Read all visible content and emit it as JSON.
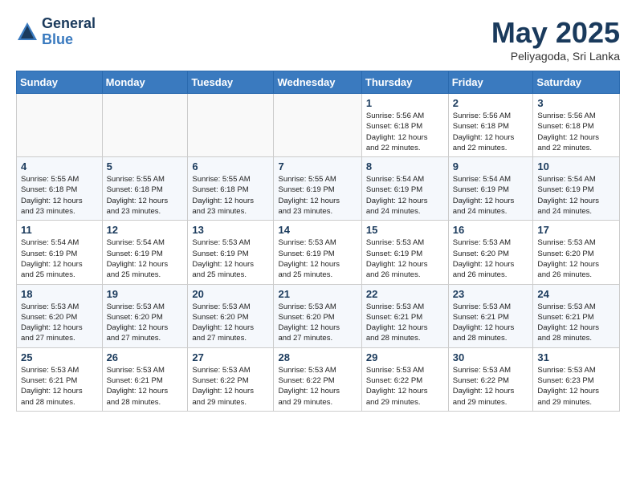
{
  "header": {
    "logo_general": "General",
    "logo_blue": "Blue",
    "month_title": "May 2025",
    "location": "Peliyagoda, Sri Lanka"
  },
  "days_of_week": [
    "Sunday",
    "Monday",
    "Tuesday",
    "Wednesday",
    "Thursday",
    "Friday",
    "Saturday"
  ],
  "weeks": [
    [
      {
        "day": "",
        "info": ""
      },
      {
        "day": "",
        "info": ""
      },
      {
        "day": "",
        "info": ""
      },
      {
        "day": "",
        "info": ""
      },
      {
        "day": "1",
        "info": "Sunrise: 5:56 AM\nSunset: 6:18 PM\nDaylight: 12 hours\nand 22 minutes."
      },
      {
        "day": "2",
        "info": "Sunrise: 5:56 AM\nSunset: 6:18 PM\nDaylight: 12 hours\nand 22 minutes."
      },
      {
        "day": "3",
        "info": "Sunrise: 5:56 AM\nSunset: 6:18 PM\nDaylight: 12 hours\nand 22 minutes."
      }
    ],
    [
      {
        "day": "4",
        "info": "Sunrise: 5:55 AM\nSunset: 6:18 PM\nDaylight: 12 hours\nand 23 minutes."
      },
      {
        "day": "5",
        "info": "Sunrise: 5:55 AM\nSunset: 6:18 PM\nDaylight: 12 hours\nand 23 minutes."
      },
      {
        "day": "6",
        "info": "Sunrise: 5:55 AM\nSunset: 6:18 PM\nDaylight: 12 hours\nand 23 minutes."
      },
      {
        "day": "7",
        "info": "Sunrise: 5:55 AM\nSunset: 6:19 PM\nDaylight: 12 hours\nand 23 minutes."
      },
      {
        "day": "8",
        "info": "Sunrise: 5:54 AM\nSunset: 6:19 PM\nDaylight: 12 hours\nand 24 minutes."
      },
      {
        "day": "9",
        "info": "Sunrise: 5:54 AM\nSunset: 6:19 PM\nDaylight: 12 hours\nand 24 minutes."
      },
      {
        "day": "10",
        "info": "Sunrise: 5:54 AM\nSunset: 6:19 PM\nDaylight: 12 hours\nand 24 minutes."
      }
    ],
    [
      {
        "day": "11",
        "info": "Sunrise: 5:54 AM\nSunset: 6:19 PM\nDaylight: 12 hours\nand 25 minutes."
      },
      {
        "day": "12",
        "info": "Sunrise: 5:54 AM\nSunset: 6:19 PM\nDaylight: 12 hours\nand 25 minutes."
      },
      {
        "day": "13",
        "info": "Sunrise: 5:53 AM\nSunset: 6:19 PM\nDaylight: 12 hours\nand 25 minutes."
      },
      {
        "day": "14",
        "info": "Sunrise: 5:53 AM\nSunset: 6:19 PM\nDaylight: 12 hours\nand 25 minutes."
      },
      {
        "day": "15",
        "info": "Sunrise: 5:53 AM\nSunset: 6:19 PM\nDaylight: 12 hours\nand 26 minutes."
      },
      {
        "day": "16",
        "info": "Sunrise: 5:53 AM\nSunset: 6:20 PM\nDaylight: 12 hours\nand 26 minutes."
      },
      {
        "day": "17",
        "info": "Sunrise: 5:53 AM\nSunset: 6:20 PM\nDaylight: 12 hours\nand 26 minutes."
      }
    ],
    [
      {
        "day": "18",
        "info": "Sunrise: 5:53 AM\nSunset: 6:20 PM\nDaylight: 12 hours\nand 27 minutes."
      },
      {
        "day": "19",
        "info": "Sunrise: 5:53 AM\nSunset: 6:20 PM\nDaylight: 12 hours\nand 27 minutes."
      },
      {
        "day": "20",
        "info": "Sunrise: 5:53 AM\nSunset: 6:20 PM\nDaylight: 12 hours\nand 27 minutes."
      },
      {
        "day": "21",
        "info": "Sunrise: 5:53 AM\nSunset: 6:20 PM\nDaylight: 12 hours\nand 27 minutes."
      },
      {
        "day": "22",
        "info": "Sunrise: 5:53 AM\nSunset: 6:21 PM\nDaylight: 12 hours\nand 28 minutes."
      },
      {
        "day": "23",
        "info": "Sunrise: 5:53 AM\nSunset: 6:21 PM\nDaylight: 12 hours\nand 28 minutes."
      },
      {
        "day": "24",
        "info": "Sunrise: 5:53 AM\nSunset: 6:21 PM\nDaylight: 12 hours\nand 28 minutes."
      }
    ],
    [
      {
        "day": "25",
        "info": "Sunrise: 5:53 AM\nSunset: 6:21 PM\nDaylight: 12 hours\nand 28 minutes."
      },
      {
        "day": "26",
        "info": "Sunrise: 5:53 AM\nSunset: 6:21 PM\nDaylight: 12 hours\nand 28 minutes."
      },
      {
        "day": "27",
        "info": "Sunrise: 5:53 AM\nSunset: 6:22 PM\nDaylight: 12 hours\nand 29 minutes."
      },
      {
        "day": "28",
        "info": "Sunrise: 5:53 AM\nSunset: 6:22 PM\nDaylight: 12 hours\nand 29 minutes."
      },
      {
        "day": "29",
        "info": "Sunrise: 5:53 AM\nSunset: 6:22 PM\nDaylight: 12 hours\nand 29 minutes."
      },
      {
        "day": "30",
        "info": "Sunrise: 5:53 AM\nSunset: 6:22 PM\nDaylight: 12 hours\nand 29 minutes."
      },
      {
        "day": "31",
        "info": "Sunrise: 5:53 AM\nSunset: 6:23 PM\nDaylight: 12 hours\nand 29 minutes."
      }
    ]
  ]
}
